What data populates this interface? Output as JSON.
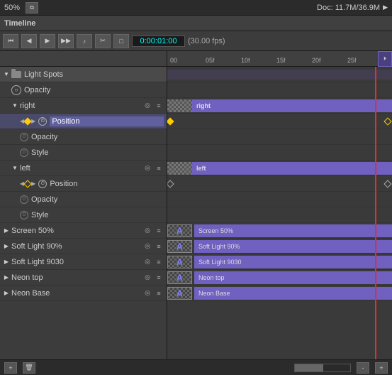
{
  "topBar": {
    "zoom": "50%",
    "docInfo": "Doc: 11.7M/36.9M",
    "arrow": "▶"
  },
  "timelineHeader": {
    "title": "Timeline"
  },
  "controls": {
    "buttons": [
      "⏮",
      "◀◀",
      "▶",
      "▶▶",
      "🔊",
      "✂",
      "□"
    ],
    "time": "0:00:01:00",
    "fps": "(30.00 fps)"
  },
  "ruler": {
    "marks": [
      "00",
      "05f",
      "10f",
      "15f",
      "20f",
      "25f"
    ]
  },
  "layers": [
    {
      "id": "light-spots",
      "label": "Light Spots",
      "type": "group",
      "indent": 0,
      "expanded": true
    },
    {
      "id": "opacity-1",
      "label": "Opacity",
      "type": "property",
      "indent": 1
    },
    {
      "id": "right",
      "label": "right",
      "type": "layer",
      "indent": 1,
      "expanded": true,
      "selected": true
    },
    {
      "id": "position-1",
      "label": "Position",
      "type": "property-active",
      "indent": 2
    },
    {
      "id": "opacity-2",
      "label": "Opacity",
      "type": "property",
      "indent": 2
    },
    {
      "id": "style-1",
      "label": "Style",
      "type": "property",
      "indent": 2
    },
    {
      "id": "left",
      "label": "left",
      "type": "layer",
      "indent": 1,
      "expanded": true
    },
    {
      "id": "position-2",
      "label": "Position",
      "type": "property",
      "indent": 2
    },
    {
      "id": "opacity-3",
      "label": "Opacity",
      "type": "property",
      "indent": 2
    },
    {
      "id": "style-2",
      "label": "Style",
      "type": "property",
      "indent": 2
    },
    {
      "id": "screen50",
      "label": "Screen 50%",
      "type": "layer",
      "indent": 0
    },
    {
      "id": "softlight90",
      "label": "Soft Light 90%",
      "type": "layer",
      "indent": 0
    },
    {
      "id": "softlight9030",
      "label": "Soft Light 9030",
      "type": "layer",
      "indent": 0
    },
    {
      "id": "neontop",
      "label": "Neon top",
      "type": "layer",
      "indent": 0
    },
    {
      "id": "neonbase",
      "label": "Neon Base",
      "type": "layer",
      "indent": 0
    }
  ],
  "tracks": [
    {
      "id": "light-spots",
      "hasBar": false,
      "barLeft": 0,
      "barWidth": 0
    },
    {
      "id": "opacity-1",
      "hasBar": false
    },
    {
      "id": "right",
      "hasBar": true,
      "barLeft": 0,
      "barWidth": 290,
      "type": "checker-purple",
      "label": "right"
    },
    {
      "id": "position-1",
      "hasBar": false,
      "hasDiamond": true,
      "diamondLeft": 0
    },
    {
      "id": "opacity-2",
      "hasBar": false
    },
    {
      "id": "style-1",
      "hasBar": false
    },
    {
      "id": "left",
      "hasBar": true,
      "barLeft": 0,
      "barWidth": 290,
      "type": "checker-purple",
      "label": "left"
    },
    {
      "id": "position-2",
      "hasBar": false,
      "hasDiamond": true
    },
    {
      "id": "opacity-3",
      "hasBar": false
    },
    {
      "id": "style-2",
      "hasBar": false
    },
    {
      "id": "screen50",
      "hasBar": true,
      "barLeft": 0,
      "barWidth": 290,
      "type": "checker-purple",
      "label": "Screen 50%"
    },
    {
      "id": "softlight90",
      "hasBar": true,
      "barLeft": 0,
      "barWidth": 290,
      "type": "checker-purple",
      "label": "Soft Light 90%"
    },
    {
      "id": "softlight9030",
      "hasBar": true,
      "barLeft": 0,
      "barWidth": 290,
      "type": "checker-purple",
      "label": "Soft Light 9030"
    },
    {
      "id": "neontop",
      "hasBar": true,
      "barLeft": 0,
      "barWidth": 290,
      "type": "checker-purple",
      "label": "Neon top"
    },
    {
      "id": "neonbase",
      "hasBar": true,
      "barLeft": 0,
      "barWidth": 290,
      "type": "checker-purple",
      "label": "Neon Base"
    }
  ],
  "colors": {
    "purple": "#7060c0",
    "selectedBg": "#5a5a8a",
    "redLine": "#e03030",
    "diamond": "#ffcc00",
    "propertyHighlight": "#6060a0"
  }
}
